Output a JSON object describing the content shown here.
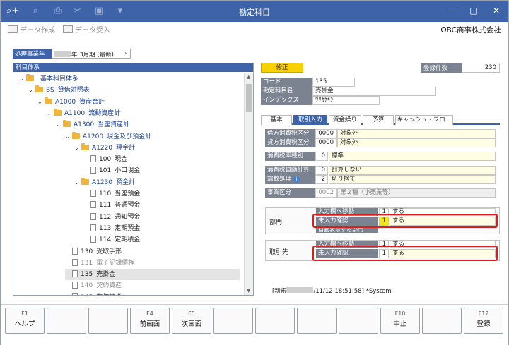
{
  "window": {
    "title": "勘定科目"
  },
  "commands": {
    "create": "データ作成",
    "import": "データ受入"
  },
  "company": "OBC商事株式会社",
  "fiscal_year": {
    "label": "処理事業年度",
    "value": "年  3月期 (最新)"
  },
  "tree": {
    "header": "科目体系",
    "nodes": [
      {
        "code": "",
        "label": "基本科目体系"
      },
      {
        "code": "BS",
        "label": "貸借対照表"
      },
      {
        "code": "A1000",
        "label": "資産合計"
      },
      {
        "code": "A1100",
        "label": "流動資産計"
      },
      {
        "code": "A1300",
        "label": "当座資産計"
      },
      {
        "code": "A1200",
        "label": "現金及び預金計"
      },
      {
        "code": "A1220",
        "label": "現金計"
      },
      {
        "code": "100",
        "label": "現金"
      },
      {
        "code": "101",
        "label": "小口現金"
      },
      {
        "code": "A1230",
        "label": "預金計"
      },
      {
        "code": "110",
        "label": "当座預金"
      },
      {
        "code": "111",
        "label": "普通預金"
      },
      {
        "code": "112",
        "label": "通知預金"
      },
      {
        "code": "113",
        "label": "定期預金"
      },
      {
        "code": "114",
        "label": "定期積金"
      },
      {
        "code": "130",
        "label": "受取手形"
      },
      {
        "code": "131",
        "label": "電子記録債権"
      },
      {
        "code": "135",
        "label": "売掛金"
      },
      {
        "code": "140",
        "label": "契約資産"
      },
      {
        "code": "145",
        "label": "有価証券"
      }
    ]
  },
  "detail": {
    "mode_button": "修正",
    "count": {
      "label": "登録件数",
      "value": "230"
    },
    "code": {
      "label": "コード",
      "value": "135"
    },
    "name": {
      "label": "勘定科目名",
      "value": "売掛金"
    },
    "index": {
      "label": "インデックス",
      "value": "ｳﾘｶｹｷﾝ"
    },
    "tabs": [
      "基本",
      "取引入力",
      "資金繰り",
      "予算",
      "キャッシュ・フロー"
    ],
    "active_tab": "取引入力",
    "tax": [
      {
        "label": "借方消費税区分",
        "num": "0000",
        "value": "対象外"
      },
      {
        "label": "貸方消費税区分",
        "num": "0000",
        "value": "対象外"
      }
    ],
    "rate_type": {
      "label": "消費税率種別",
      "num": "0",
      "value": "標準"
    },
    "auto_calc": {
      "label": "消費税自動計算",
      "num": "0",
      "value": "計算しない"
    },
    "rounding": {
      "label": "端数処理",
      "num": "2",
      "value": "切り捨て",
      "icon": "info-icon"
    },
    "business": {
      "label": "事業区分",
      "num": "0002",
      "value": "第２種（小売業等）"
    },
    "dept": {
      "title": "部門",
      "rows": [
        {
          "label": "入力欄へ移動",
          "num": "1",
          "value": "する"
        },
        {
          "label": "未入力確認",
          "num": "1",
          "value": "する"
        },
        {
          "label": "自動表示する部門",
          "num": "",
          "value": ""
        }
      ]
    },
    "partner": {
      "title": "取引先",
      "rows": [
        {
          "label": "入力欄へ移動",
          "num": "1",
          "value": "する"
        },
        {
          "label": "未入力確認",
          "num": "1",
          "value": "する"
        }
      ]
    },
    "status": {
      "prefix": "[新規",
      "date": "/11/12 18:51:58]",
      "user": "*System"
    }
  },
  "fkeys": [
    {
      "key": "F1",
      "label": "ヘルプ"
    },
    {
      "key": "",
      "label": ""
    },
    {
      "key": "",
      "label": ""
    },
    {
      "key": "F4",
      "label": "前画面"
    },
    {
      "key": "F5",
      "label": "次画面"
    },
    {
      "key": "",
      "label": ""
    },
    {
      "key": "",
      "label": ""
    },
    {
      "key": "",
      "label": ""
    },
    {
      "key": "",
      "label": ""
    },
    {
      "key": "F10",
      "label": "中止"
    },
    {
      "key": "",
      "label": ""
    },
    {
      "key": "F12",
      "label": "登録"
    }
  ],
  "colors": {
    "titlebar": "#3f63a8",
    "highlight": "#e11b1b",
    "mode_button": "#f6d000"
  }
}
